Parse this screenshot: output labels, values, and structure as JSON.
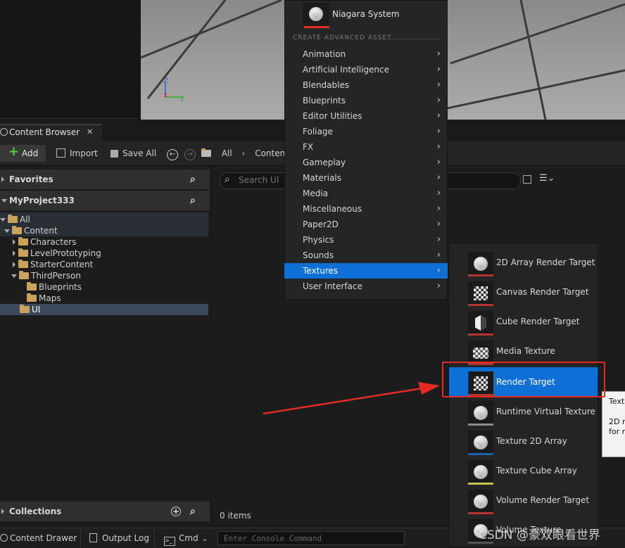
{
  "viewport": {
    "axis_z": "Z",
    "axis_x": "x",
    "axis_y": "y"
  },
  "content_browser": {
    "tab_label": "Content Browser",
    "tab_close": "✕",
    "toolbar": {
      "add_label": "Add",
      "import_label": "Import",
      "save_all_label": "Save All",
      "breadcrumb": [
        "All",
        "Content"
      ]
    },
    "favorites_label": "Favorites",
    "project_label": "MyProject333",
    "tree": [
      {
        "label": "All",
        "depth": 0,
        "expanded": true
      },
      {
        "label": "Content",
        "depth": 1,
        "expanded": true
      },
      {
        "label": "Characters",
        "depth": 2,
        "expanded": false
      },
      {
        "label": "LevelPrototyping",
        "depth": 2,
        "expanded": false
      },
      {
        "label": "StarterContent",
        "depth": 2,
        "expanded": false
      },
      {
        "label": "ThirdPerson",
        "depth": 2,
        "expanded": true
      },
      {
        "label": "Blueprints",
        "depth": 3,
        "expanded": false
      },
      {
        "label": "Maps",
        "depth": 3,
        "expanded": false
      },
      {
        "label": "UI",
        "depth": 2,
        "expanded": false,
        "selected": true
      }
    ],
    "collections_label": "Collections",
    "search_placeholder": "Search UI",
    "item_count": "0 items"
  },
  "bottom_bar": {
    "content_drawer": "Content Drawer",
    "output_log": "Output Log",
    "cmd": "Cmd",
    "console_placeholder": "Enter Console Command"
  },
  "menu": {
    "top_item": "Niagara System",
    "section_header": "CREATE ADVANCED ASSET",
    "items": [
      "Animation",
      "Artificial Intelligence",
      "Blendables",
      "Blueprints",
      "Editor Utilities",
      "Foliage",
      "FX",
      "Gameplay",
      "Materials",
      "Media",
      "Miscellaneous",
      "Paper2D",
      "Physics",
      "Sounds",
      "Textures",
      "User Interface"
    ],
    "highlighted": "Textures"
  },
  "submenu": {
    "items": [
      {
        "label": "2D Array Render Target",
        "icon": "ball",
        "bar": "#b2352f"
      },
      {
        "label": "Canvas Render Target",
        "icon": "checker",
        "bar": "#b2352f"
      },
      {
        "label": "Cube Render Target",
        "icon": "cube",
        "bar": "#b2352f"
      },
      {
        "label": "Media Texture",
        "icon": "tv",
        "bar": "#b2352f"
      },
      {
        "label": "Render Target",
        "icon": "checker",
        "bar": "#b2352f"
      },
      {
        "label": "Runtime Virtual Texture",
        "icon": "ball",
        "bar": "#8d8d8d"
      },
      {
        "label": "Texture 2D Array",
        "icon": "ball",
        "bar": "#1f5fa8"
      },
      {
        "label": "Texture Cube Array",
        "icon": "ball",
        "bar": "#c5c24f"
      },
      {
        "label": "Volume Render Target",
        "icon": "ball",
        "bar": "#b2352f"
      },
      {
        "label": "Volume Texture",
        "icon": "ball",
        "bar": "#555555"
      }
    ],
    "highlighted": "Render Target"
  },
  "tooltip": {
    "line1": "Text",
    "line2": "2D r",
    "line3": "for r"
  },
  "watermark": "CSDN @豪双眼看世界",
  "colors": {
    "accent": "#0e70d6",
    "annotation": "#e52b23",
    "folder": "#c9a35b"
  }
}
